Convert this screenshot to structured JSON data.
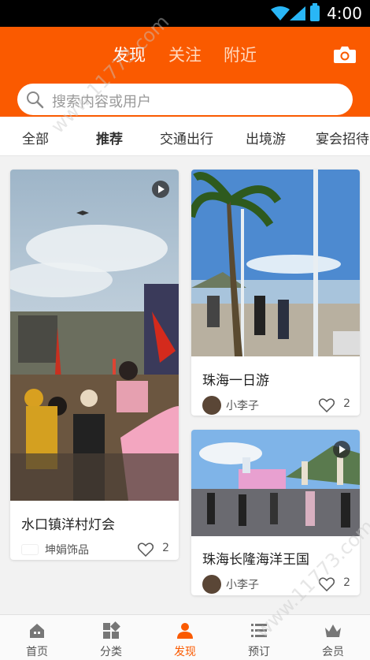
{
  "status_bar": {
    "time": "4:00"
  },
  "header": {
    "tabs": [
      {
        "label": "发现",
        "active": true
      },
      {
        "label": "关注",
        "active": false
      },
      {
        "label": "附近",
        "active": false
      }
    ],
    "camera_icon": "camera-icon",
    "brand_color": "#fa5a00"
  },
  "search": {
    "placeholder": "搜索内容或用户"
  },
  "categories": [
    {
      "label": "全部",
      "active": false
    },
    {
      "label": "推荐",
      "active": true
    },
    {
      "label": "交通出行",
      "active": false
    },
    {
      "label": "出境游",
      "active": false
    },
    {
      "label": "宴会招待",
      "active": false
    }
  ],
  "feed": [
    {
      "title": "水口镇洋村灯会",
      "author": "坤娟饰品",
      "likes": "2",
      "video": true
    },
    {
      "title": "珠海一日游",
      "author": "小李子",
      "likes": "2",
      "video": false
    },
    {
      "title": "珠海长隆海洋王国",
      "author": "小李子",
      "likes": "2",
      "video": true
    }
  ],
  "bottom_nav": [
    {
      "label": "首页",
      "icon": "home-icon",
      "active": false
    },
    {
      "label": "分类",
      "icon": "grid-icon",
      "active": false
    },
    {
      "label": "发现",
      "icon": "user-icon",
      "active": true
    },
    {
      "label": "预订",
      "icon": "list-icon",
      "active": false
    },
    {
      "label": "会员",
      "icon": "crown-icon",
      "active": false
    }
  ],
  "watermark": "www.11773.com"
}
